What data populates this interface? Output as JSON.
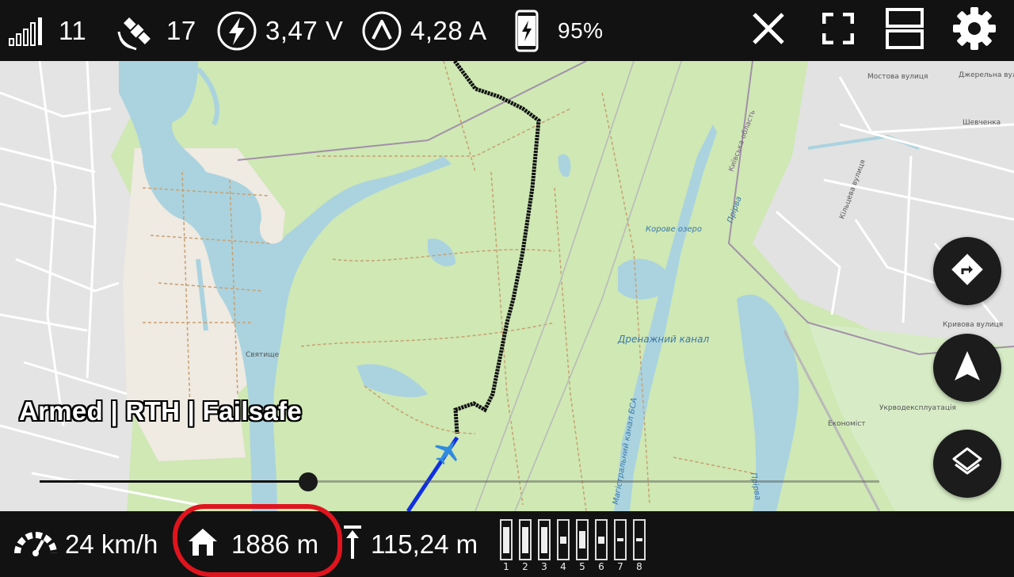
{
  "top_bar": {
    "signal": {
      "icon": "signal-bars-icon",
      "value": "11"
    },
    "satellites": {
      "icon": "satellite-icon",
      "value": "17"
    },
    "voltage": {
      "icon": "lightning-icon",
      "value": "3,47 V"
    },
    "current": {
      "icon": "current-amp-icon",
      "value": "4,28 A"
    },
    "phone_battery": {
      "icon": "phone-battery-icon",
      "value": "95%"
    },
    "buttons": [
      "close-icon",
      "fullscreen-icon",
      "split-view-icon",
      "gear-icon"
    ]
  },
  "map": {
    "labels": {
      "lake": "Корове озеро",
      "canal": "Дренажний канал",
      "village": "Святище",
      "company": "Укрводексплуатація",
      "eco": "Економіст",
      "river1": "Прірва",
      "river2": "Прірва",
      "bsa": "Магістральний канал БСА",
      "oblast": "Київська область",
      "street1": "Мостова вулиця",
      "street2": "Шевченка",
      "street3": "Кільцева вулиця",
      "street4": "Кривова вулиця",
      "street5": "Джерельна вулиця"
    },
    "colors": {
      "track_flown": "#111111",
      "track_current": "#1030e0",
      "plane": "#2f8be0"
    }
  },
  "status_text": "Armed | RTH | Failsafe",
  "fabs": [
    "route-icon",
    "navigation-arrow-icon",
    "layers-icon"
  ],
  "playback": {
    "progress": 0.32
  },
  "bottom_bar": {
    "speed": {
      "icon": "speedometer-icon",
      "value": "24 km/h"
    },
    "home_distance": {
      "icon": "home-icon",
      "value": "1886 m"
    },
    "altitude": {
      "icon": "altitude-icon",
      "value": "115,24 m"
    },
    "channels": [
      {
        "label": "1",
        "level": 0.75
      },
      {
        "label": "2",
        "level": 0.75
      },
      {
        "label": "3",
        "level": 0.75
      },
      {
        "label": "4",
        "level": 0.2
      },
      {
        "label": "5",
        "level": 0.5
      },
      {
        "label": "6",
        "level": 0.2
      },
      {
        "label": "7",
        "level": 0.1
      },
      {
        "label": "8",
        "level": 0.1
      }
    ]
  },
  "highlight_color": "#e0141e"
}
